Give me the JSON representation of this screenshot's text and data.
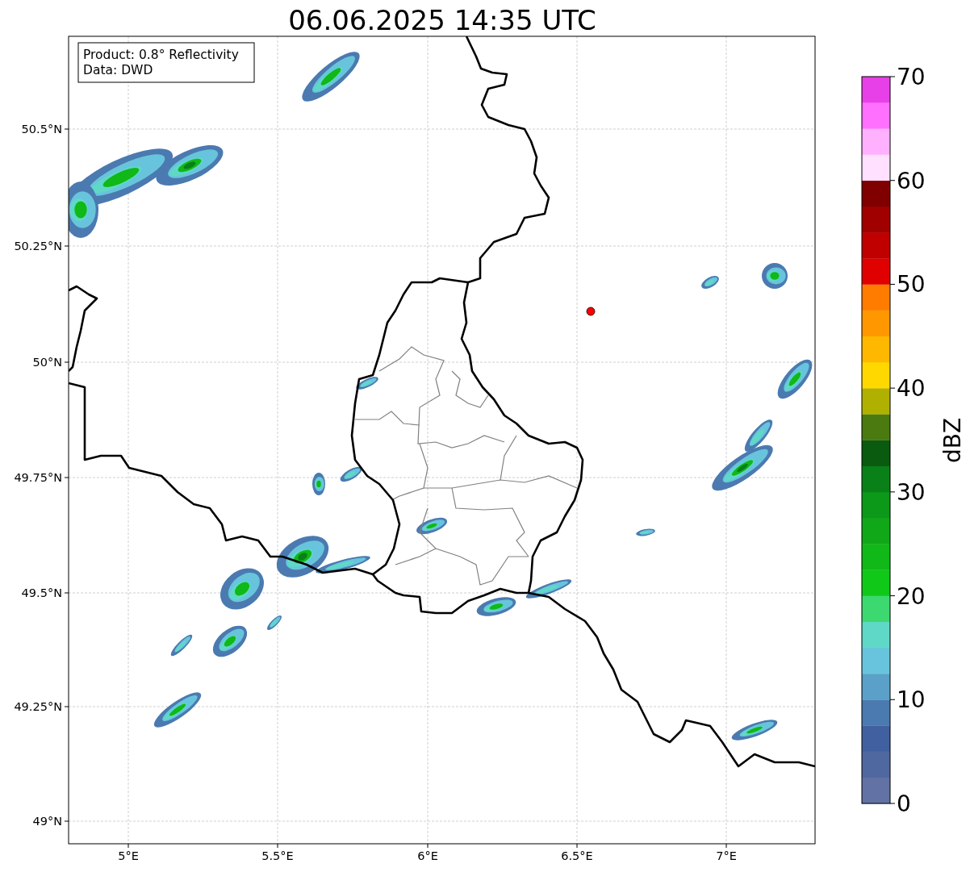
{
  "title": "06.06.2025 14:35 UTC",
  "legend": [
    "Product: 0.8° Reflectivity",
    "Data: DWD"
  ],
  "x_ticks": [
    "5°E",
    "5.5°E",
    "6°E",
    "6.5°E",
    "7°E"
  ],
  "y_ticks": [
    "50.5°N",
    "50.25°N",
    "50°N",
    "49.75°N",
    "49.5°N",
    "49.25°N",
    "49°N"
  ],
  "colorbar": {
    "label": "dBZ",
    "ticks": [
      "70",
      "60",
      "50",
      "40",
      "30",
      "20",
      "10",
      "0"
    ],
    "segments": [
      {
        "color": "#6272a4"
      },
      {
        "color": "#5068a0"
      },
      {
        "color": "#4060a0"
      },
      {
        "color": "#4a7ab0"
      },
      {
        "color": "#5aa0c8"
      },
      {
        "color": "#68c4dc"
      },
      {
        "color": "#60d8c8"
      },
      {
        "color": "#3cd870"
      },
      {
        "color": "#10c818"
      },
      {
        "color": "#10b818"
      },
      {
        "color": "#10a818"
      },
      {
        "color": "#0c9818"
      },
      {
        "color": "#0a8018"
      },
      {
        "color": "#0a5a10"
      },
      {
        "color": "#4a7a10"
      },
      {
        "color": "#b0b000"
      },
      {
        "color": "#ffd800"
      },
      {
        "color": "#ffb800"
      },
      {
        "color": "#ff9800"
      },
      {
        "color": "#ff7c00"
      },
      {
        "color": "#e00000"
      },
      {
        "color": "#c00000"
      },
      {
        "color": "#a00000"
      },
      {
        "color": "#800000"
      },
      {
        "color": "#ffe0ff"
      },
      {
        "color": "#ffb0ff"
      },
      {
        "color": "#ff70ff"
      },
      {
        "color": "#e840e8"
      }
    ]
  }
}
